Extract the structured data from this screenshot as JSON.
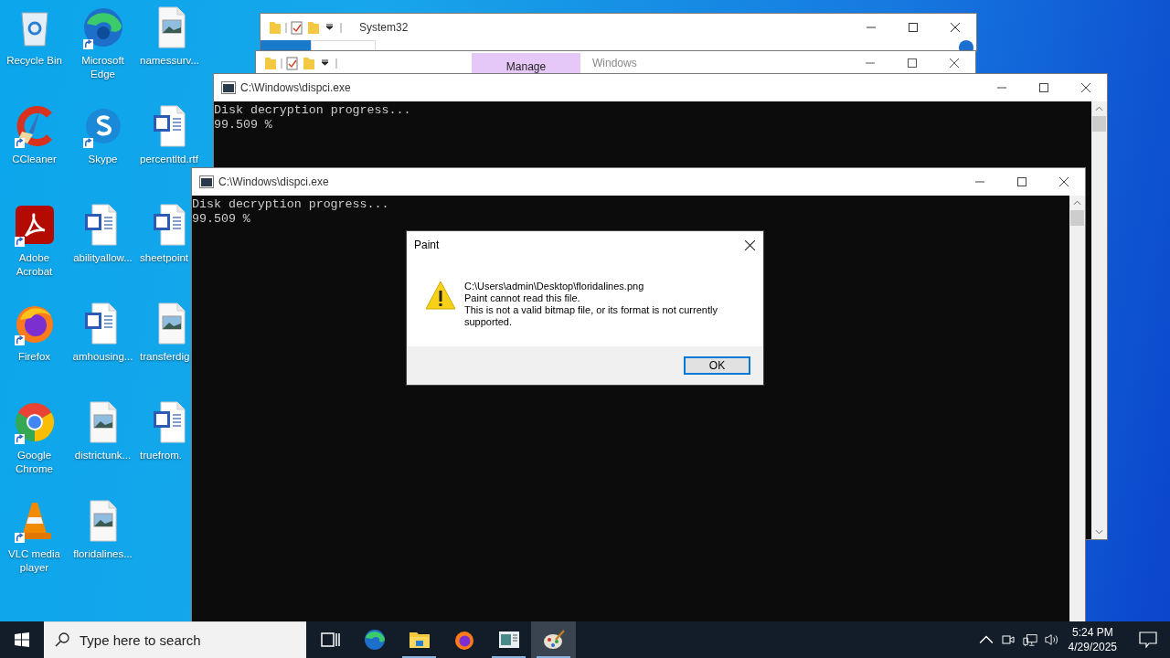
{
  "desktop_icons": [
    {
      "label": "Recycle Bin",
      "kind": "recycle",
      "shortcut": false
    },
    {
      "label": "CCleaner",
      "kind": "ccleaner",
      "shortcut": true
    },
    {
      "label": "Adobe Acrobat",
      "kind": "acrobat",
      "shortcut": true
    },
    {
      "label": "Firefox",
      "kind": "firefox",
      "shortcut": true
    },
    {
      "label": "Google Chrome",
      "kind": "chrome",
      "shortcut": true
    },
    {
      "label": "VLC media player",
      "kind": "vlc",
      "shortcut": true
    },
    {
      "label": "Microsoft Edge",
      "kind": "edge",
      "shortcut": true
    },
    {
      "label": "Skype",
      "kind": "skype",
      "shortcut": true
    },
    {
      "label": "abilityallow...",
      "kind": "word",
      "shortcut": false
    },
    {
      "label": "amhousing...",
      "kind": "word",
      "shortcut": false
    },
    {
      "label": "districtunk...",
      "kind": "image",
      "shortcut": false
    },
    {
      "label": "floridalines...",
      "kind": "image",
      "shortcut": false
    },
    {
      "label": "namessurv...",
      "kind": "image",
      "shortcut": false
    },
    {
      "label": "percentltd.rtf",
      "kind": "word",
      "shortcut": false
    },
    {
      "label": "sheetpoint",
      "kind": "word",
      "shortcut": false
    },
    {
      "label": "transferdig",
      "kind": "image",
      "shortcut": false
    },
    {
      "label": "truefrom.",
      "kind": "word",
      "shortcut": false
    }
  ],
  "explorer_windows": [
    {
      "title": "System32"
    },
    {
      "title": "Windows",
      "context_tab": "Manage"
    }
  ],
  "consoles": [
    {
      "title": "C:\\Windows\\dispci.exe",
      "lines": [
        "Disk decryption progress...",
        "99.509 %"
      ]
    },
    {
      "title": "C:\\Windows\\dispci.exe",
      "lines": [
        "Disk decryption progress...",
        "99.509 %"
      ]
    }
  ],
  "dialog": {
    "title": "Paint",
    "lines": [
      "C:\\Users\\admin\\Desktop\\floridalines.png",
      "Paint cannot read this file.",
      "This is not a valid bitmap file, or its format is not currently supported."
    ],
    "button": "OK"
  },
  "taskbar": {
    "search_placeholder": "Type here to search",
    "apps": [
      {
        "kind": "taskview",
        "running": false,
        "active": false
      },
      {
        "kind": "edge",
        "running": false,
        "active": false
      },
      {
        "kind": "explorer",
        "running": true,
        "active": false
      },
      {
        "kind": "firefox",
        "running": false,
        "active": false
      },
      {
        "kind": "terminal",
        "running": true,
        "active": false
      },
      {
        "kind": "paint",
        "running": true,
        "active": true
      }
    ],
    "time": "5:24 PM",
    "date": "4/29/2025"
  }
}
